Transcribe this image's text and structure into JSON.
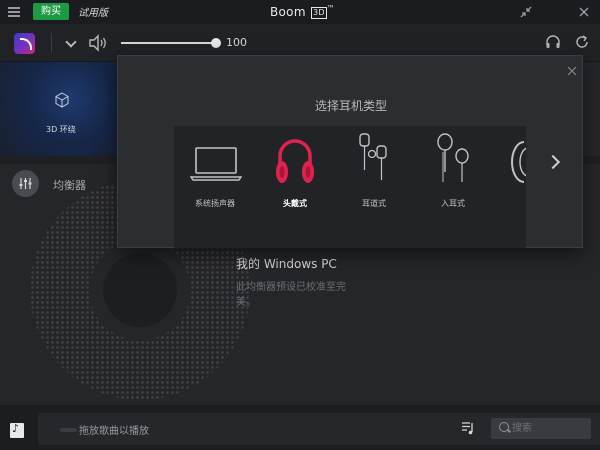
{
  "titlebar": {
    "buy_label": "购买",
    "trial_label": "试用版",
    "app_name": "Boom",
    "app_badge": "3D",
    "trademark": "™"
  },
  "controls": {
    "volume_value": "100",
    "volume_level": 1.0
  },
  "sidebar": {
    "surround_label": "3D 环绕",
    "equalizer_label": "均衡器"
  },
  "device": {
    "name": "我的 Windows PC",
    "description": "此均衡器预设已校准至完美。"
  },
  "dialog": {
    "title": "选择耳机类型",
    "options": [
      {
        "label": "系统扬声器",
        "icon": "laptop-icon",
        "selected": false
      },
      {
        "label": "头戴式",
        "icon": "over-ear-headphones-icon",
        "selected": true
      },
      {
        "label": "耳道式",
        "icon": "earbuds-icon",
        "selected": false
      },
      {
        "label": "入耳式",
        "icon": "in-ear-icon",
        "selected": false
      }
    ]
  },
  "player": {
    "drop_label": "拖放歌曲以播放",
    "search_placeholder": "搜索"
  },
  "colors": {
    "accent_green": "#1d9a43",
    "selected_red": "#e0224e",
    "background": "#25262a"
  }
}
